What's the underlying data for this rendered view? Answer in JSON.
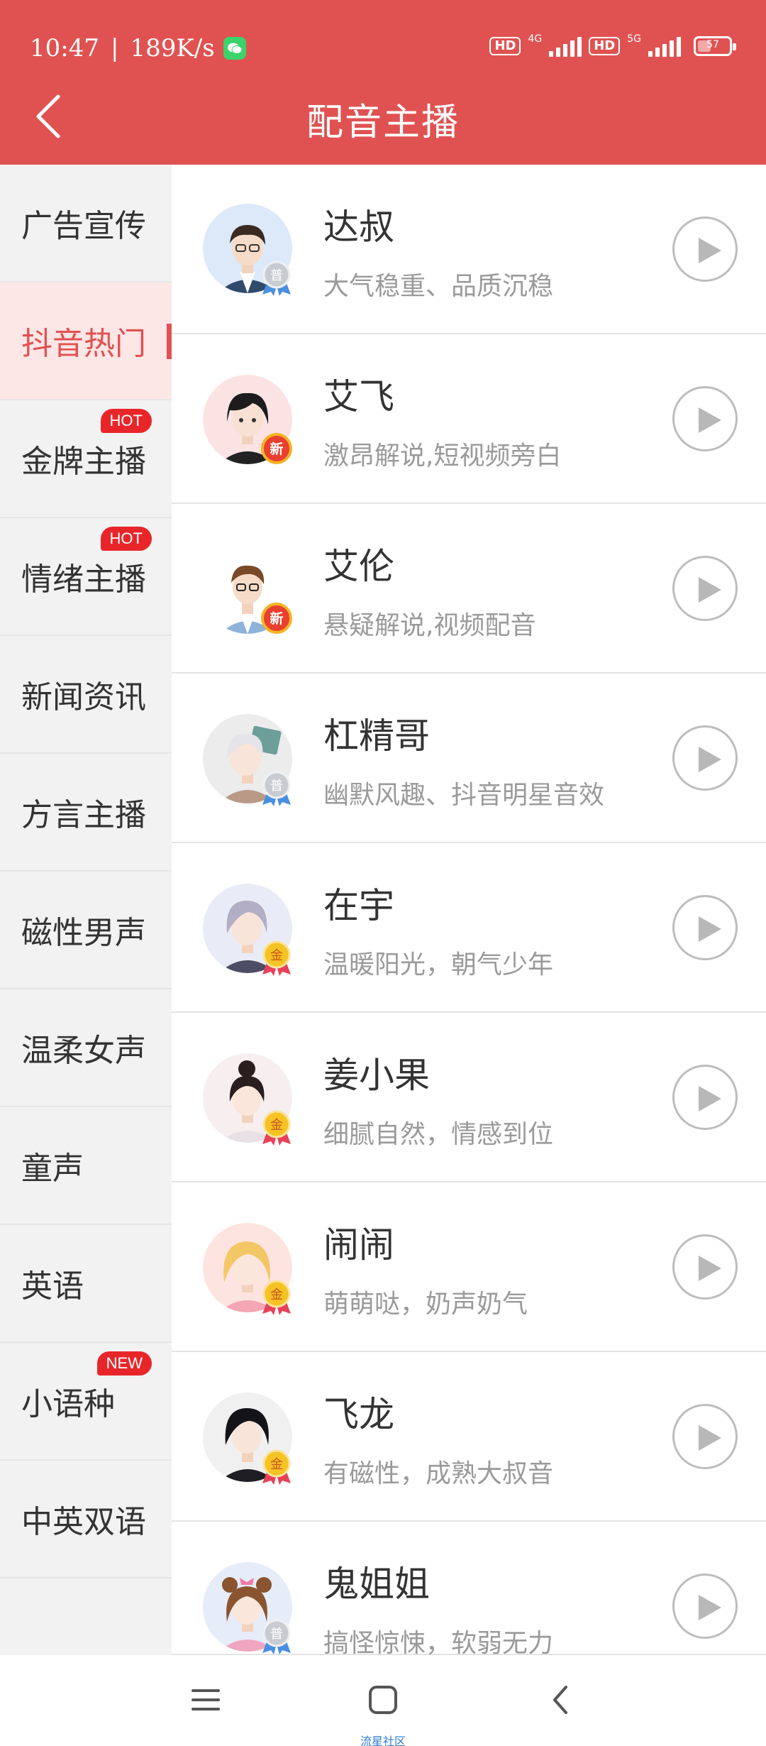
{
  "status_bar": {
    "time": "10:47",
    "net_speed": "189K/s",
    "hd1": "HD",
    "net1": "4G",
    "hd2": "HD",
    "net2": "5G",
    "battery": "57"
  },
  "header": {
    "title": "配音主播",
    "color": "#e05252"
  },
  "sidebar": {
    "items": [
      {
        "label": "广告宣传",
        "badge": ""
      },
      {
        "label": "抖音热门",
        "badge": "",
        "active": true
      },
      {
        "label": "金牌主播",
        "badge": "HOT"
      },
      {
        "label": "情绪主播",
        "badge": "HOT"
      },
      {
        "label": "新闻资讯",
        "badge": ""
      },
      {
        "label": "方言主播",
        "badge": ""
      },
      {
        "label": "磁性男声",
        "badge": ""
      },
      {
        "label": "温柔女声",
        "badge": ""
      },
      {
        "label": "童声",
        "badge": ""
      },
      {
        "label": "英语",
        "badge": ""
      },
      {
        "label": "小语种",
        "badge": "NEW"
      },
      {
        "label": "中英双语",
        "badge": ""
      }
    ]
  },
  "anchors": [
    {
      "name": "达叔",
      "desc": "大气稳重、品质沉稳",
      "medal": "普",
      "medal_type": "silver"
    },
    {
      "name": "艾飞",
      "desc": "激昂解说,短视频旁白",
      "medal": "新",
      "medal_type": "new"
    },
    {
      "name": "艾伦",
      "desc": "悬疑解说,视频配音",
      "medal": "新",
      "medal_type": "new"
    },
    {
      "name": "杠精哥",
      "desc": "幽默风趣、抖音明星音效",
      "medal": "普",
      "medal_type": "silver"
    },
    {
      "name": "在宇",
      "desc": "温暖阳光，朝气少年",
      "medal": "金",
      "medal_type": "gold"
    },
    {
      "name": "姜小果",
      "desc": "细腻自然，情感到位",
      "medal": "金",
      "medal_type": "gold"
    },
    {
      "name": "闹闹",
      "desc": "萌萌哒，奶声奶气",
      "medal": "金",
      "medal_type": "gold"
    },
    {
      "name": "飞龙",
      "desc": "有磁性，成熟大叔音",
      "medal": "金",
      "medal_type": "gold"
    },
    {
      "name": "鬼姐姐",
      "desc": "搞怪惊悚，软弱无力",
      "medal": "普",
      "medal_type": "silver"
    }
  ],
  "navbar": {
    "caption": "流星社区"
  }
}
